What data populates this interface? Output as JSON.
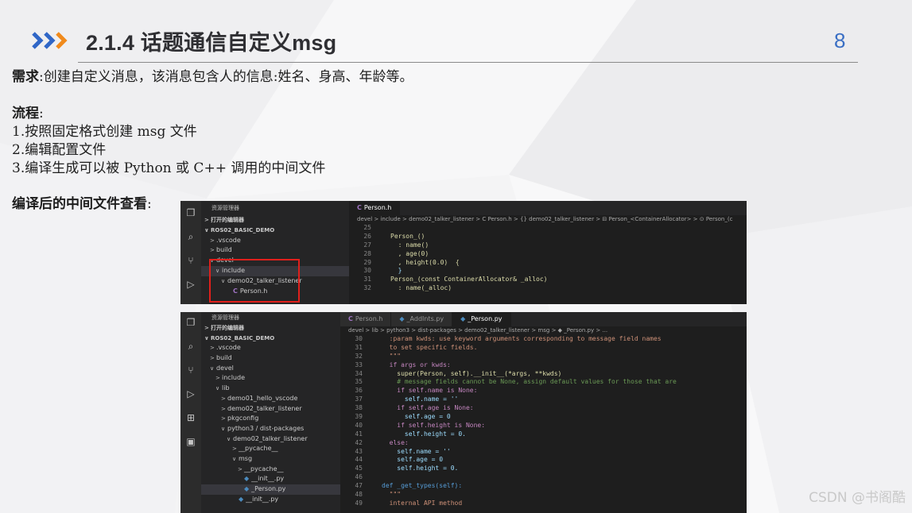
{
  "slide": {
    "title": "2.1.4 话题通信自定义msg",
    "page_number": "8",
    "watermark": "CSDN @书阁酷",
    "accent_color": "#3a6fc4",
    "chevron_colors": [
      "#2f66c7",
      "#2f66c7",
      "#f08a1c"
    ]
  },
  "requirement": {
    "label": "需求",
    "text": ":创建自定义消息，该消息包含人的信息:姓名、身高、年龄等。"
  },
  "process": {
    "label": "流程",
    "colon": ":",
    "steps": [
      "1.按照固定格式创建 msg 文件",
      "2.编辑配置文件",
      "3.编译生成可以被 Python 或 C++ 调用的中间文件"
    ]
  },
  "view_label": {
    "label": "编译后的中间文件查看",
    "colon": ":"
  },
  "panel1": {
    "explorer_header": "资源管理器",
    "tree": [
      {
        "label": "打开的编辑器",
        "arrow": ">",
        "indent": 0,
        "bold": true
      },
      {
        "label": "ROS02_BASIC_DEMO",
        "arrow": "∨",
        "indent": 0,
        "bold": true
      },
      {
        "label": ".vscode",
        "arrow": ">",
        "indent": 1
      },
      {
        "label": "build",
        "arrow": ">",
        "indent": 1
      },
      {
        "label": "devel",
        "arrow": "∨",
        "indent": 1
      },
      {
        "label": "include",
        "arrow": "∨",
        "indent": 2,
        "selected": true
      },
      {
        "label": "demo02_talker_listener",
        "arrow": "∨",
        "indent": 3
      },
      {
        "label": "Person.h",
        "arrow": "",
        "indent": 4,
        "file": "C"
      }
    ],
    "tab": "Person.h",
    "breadcrumb": "devel > include > demo02_talker_listener > C Person.h > {} demo02_talker_listener > ⊟ Person_<ContainerAllocator> > ⊙ Person_(c",
    "code": [
      {
        "n": "25",
        "t": ""
      },
      {
        "n": "26",
        "t": "Person_()"
      },
      {
        "n": "27",
        "t": "  : name()"
      },
      {
        "n": "28",
        "t": "  , age(0)"
      },
      {
        "n": "29",
        "t": "  , height(0.0)  {"
      },
      {
        "n": "30",
        "t": "  }"
      },
      {
        "n": "31",
        "t": "Person_(const ContainerAllocator& _alloc)"
      },
      {
        "n": "32",
        "t": "  : name(_alloc)"
      }
    ]
  },
  "panel2": {
    "explorer_header": "资源管理器",
    "tree": [
      {
        "label": "打开的编辑器",
        "arrow": ">",
        "indent": 0,
        "bold": true
      },
      {
        "label": "ROS02_BASIC_DEMO",
        "arrow": "∨",
        "indent": 0,
        "bold": true
      },
      {
        "label": ".vscode",
        "arrow": ">",
        "indent": 1
      },
      {
        "label": "build",
        "arrow": ">",
        "indent": 1
      },
      {
        "label": "devel",
        "arrow": "∨",
        "indent": 1
      },
      {
        "label": "include",
        "arrow": ">",
        "indent": 2
      },
      {
        "label": "lib",
        "arrow": "∨",
        "indent": 2
      },
      {
        "label": "demo01_hello_vscode",
        "arrow": ">",
        "indent": 3
      },
      {
        "label": "demo02_talker_listener",
        "arrow": ">",
        "indent": 3
      },
      {
        "label": "pkgconfig",
        "arrow": ">",
        "indent": 3
      },
      {
        "label": "python3 / dist-packages",
        "arrow": "∨",
        "indent": 3
      },
      {
        "label": "demo02_talker_listener",
        "arrow": "∨",
        "indent": 4
      },
      {
        "label": "__pycache__",
        "arrow": ">",
        "indent": 5
      },
      {
        "label": "msg",
        "arrow": "∨",
        "indent": 5
      },
      {
        "label": "__pycache__",
        "arrow": ">",
        "indent": 6
      },
      {
        "label": "__init__.py",
        "arrow": "",
        "indent": 6,
        "file": "PY"
      },
      {
        "label": "_Person.py",
        "arrow": "",
        "indent": 6,
        "file": "PY",
        "selected": true
      },
      {
        "label": "__init__.py",
        "arrow": "",
        "indent": 5,
        "file": "PY"
      }
    ],
    "tabs": [
      {
        "label": "Person.h",
        "icon": "C"
      },
      {
        "label": "_AddInts.py",
        "icon": "◆"
      },
      {
        "label": "_Person.py",
        "icon": "◆",
        "active": true
      }
    ],
    "breadcrumb": "devel > lib > python3 > dist-packages > demo02_talker_listener > msg > ◆ _Person.py > ...",
    "code": [
      {
        "n": "30",
        "t": "  :param kwds: use keyword arguments corresponding to message field names",
        "c": "str"
      },
      {
        "n": "31",
        "t": "  to set specific fields.",
        "c": "str"
      },
      {
        "n": "32",
        "t": "  \"\"\"",
        "c": "str"
      },
      {
        "n": "33",
        "t": "  if args or kwds:",
        "c": "kw"
      },
      {
        "n": "34",
        "t": "    super(Person, self).__init__(*args, **kwds)",
        "c": "fn"
      },
      {
        "n": "35",
        "t": "    # message fields cannot be None, assign default values for those that are",
        "c": "cm"
      },
      {
        "n": "36",
        "t": "    if self.name is None:",
        "c": "kw"
      },
      {
        "n": "37",
        "t": "      self.name = ''",
        "c": "as"
      },
      {
        "n": "38",
        "t": "    if self.age is None:",
        "c": "kw"
      },
      {
        "n": "39",
        "t": "      self.age = 0",
        "c": "as"
      },
      {
        "n": "40",
        "t": "    if self.height is None:",
        "c": "kw"
      },
      {
        "n": "41",
        "t": "      self.height = 0.",
        "c": "as"
      },
      {
        "n": "42",
        "t": "  else:",
        "c": "kw"
      },
      {
        "n": "43",
        "t": "    self.name = ''",
        "c": "as"
      },
      {
        "n": "44",
        "t": "    self.age = 0",
        "c": "as"
      },
      {
        "n": "45",
        "t": "    self.height = 0.",
        "c": "as"
      },
      {
        "n": "46",
        "t": "",
        "c": ""
      },
      {
        "n": "47",
        "t": "def _get_types(self):",
        "c": "def"
      },
      {
        "n": "48",
        "t": "  \"\"\"",
        "c": "str"
      },
      {
        "n": "49",
        "t": "  internal API method",
        "c": "str"
      }
    ]
  }
}
